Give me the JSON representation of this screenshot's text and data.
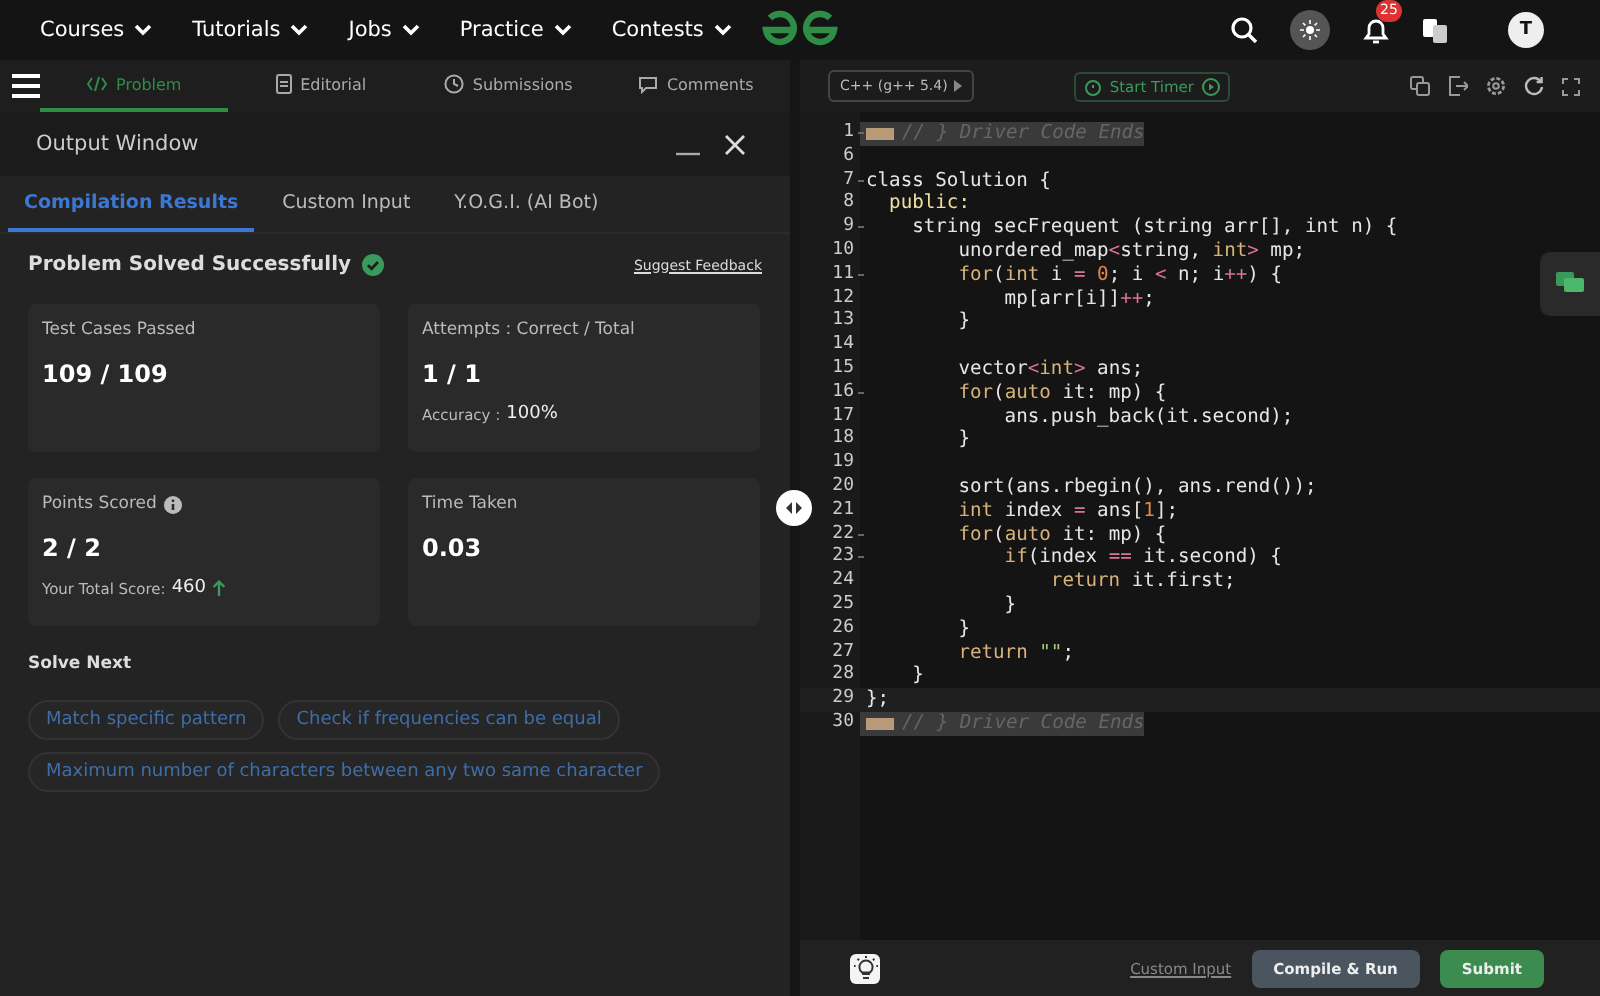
{
  "nav": {
    "menus": [
      "Courses",
      "Tutorials",
      "Jobs",
      "Practice",
      "Contests"
    ],
    "notifications": "25",
    "avatar": "T"
  },
  "problem_tabs": [
    {
      "label": "Problem",
      "kind": "code",
      "selected": true
    },
    {
      "label": "Editorial",
      "kind": "doc",
      "selected": false
    },
    {
      "label": "Submissions",
      "kind": "clock",
      "selected": false
    },
    {
      "label": "Comments",
      "kind": "chat",
      "selected": false
    }
  ],
  "output_window": {
    "title": "Output Window",
    "tabs": [
      {
        "label": "Compilation Results",
        "selected": true
      },
      {
        "label": "Custom Input",
        "selected": false
      },
      {
        "label": "Y.O.G.I. (AI Bot)",
        "selected": false
      }
    ],
    "status": "Problem Solved Successfully",
    "feedback_link": "Suggest Feedback",
    "cards": [
      {
        "label": "Test Cases Passed",
        "value": "109 / 109"
      },
      {
        "label": "Attempts : Correct / Total",
        "value": "1 / 1",
        "note_label": "Accuracy :",
        "note_value": "100%"
      },
      {
        "label": "Points Scored",
        "info": true,
        "value": "2 / 2",
        "note_label": "Your Total Score:",
        "note_value": "460",
        "trend_up": true
      },
      {
        "label": "Time Taken",
        "value": "0.03"
      }
    ],
    "solve_next": {
      "title": "Solve Next",
      "problems": [
        "Match specific pattern",
        "Check if frequencies can be equal",
        "Maximum number of characters between any two same character"
      ]
    }
  },
  "editor": {
    "language": "C++ (g++ 5.4)",
    "timer_button": "Start Timer",
    "lines": [
      {
        "number": "1",
        "foldable": true,
        "folded": true,
        "tokens": [
          {
            "text": "// } Driver Code Ends",
            "kind": "comment"
          }
        ]
      },
      {
        "number": "6"
      },
      {
        "number": "7",
        "foldable": true,
        "tokens": [
          {
            "text": "class Solution {",
            "kind": "plain"
          }
        ]
      },
      {
        "number": "8",
        "tokens": [
          {
            "text": "  public:",
            "kind": "label"
          }
        ]
      },
      {
        "number": "9",
        "foldable": true,
        "tokens": [
          {
            "text": "    string secFrequent (string arr[], int n) {",
            "kind": "plain"
          }
        ]
      },
      {
        "number": "10",
        "tokens": [
          {
            "text": "        unordered_map",
            "kind": "plain"
          },
          {
            "text": "<",
            "kind": "operator"
          },
          {
            "text": "string, ",
            "kind": "plain"
          },
          {
            "text": "int",
            "kind": "keyword"
          },
          {
            "text": ">",
            "kind": "operator"
          },
          {
            "text": " mp;",
            "kind": "plain"
          }
        ]
      },
      {
        "number": "11",
        "foldable": true,
        "tokens": [
          {
            "text": "        for",
            "kind": "keyword"
          },
          {
            "text": "(",
            "kind": "plain"
          },
          {
            "text": "int",
            "kind": "keyword"
          },
          {
            "text": " i ",
            "kind": "plain"
          },
          {
            "text": "=",
            "kind": "operator"
          },
          {
            "text": " 0",
            "kind": "number"
          },
          {
            "text": "; i ",
            "kind": "plain"
          },
          {
            "text": "<",
            "kind": "operator"
          },
          {
            "text": " n; i",
            "kind": "plain"
          },
          {
            "text": "++",
            "kind": "operator"
          },
          {
            "text": ") {",
            "kind": "plain"
          }
        ]
      },
      {
        "number": "12",
        "tokens": [
          {
            "text": "            mp[arr[i]]",
            "kind": "plain"
          },
          {
            "text": "++",
            "kind": "operator"
          },
          {
            "text": ";",
            "kind": "plain"
          }
        ]
      },
      {
        "number": "13",
        "tokens": [
          {
            "text": "        }",
            "kind": "plain"
          }
        ]
      },
      {
        "number": "14"
      },
      {
        "number": "15",
        "tokens": [
          {
            "text": "        vector",
            "kind": "plain"
          },
          {
            "text": "<",
            "kind": "operator"
          },
          {
            "text": "int",
            "kind": "keyword"
          },
          {
            "text": ">",
            "kind": "operator"
          },
          {
            "text": " ans;",
            "kind": "plain"
          }
        ]
      },
      {
        "number": "16",
        "foldable": true,
        "tokens": [
          {
            "text": "        for",
            "kind": "keyword"
          },
          {
            "text": "(",
            "kind": "plain"
          },
          {
            "text": "auto",
            "kind": "keyword"
          },
          {
            "text": " it: mp) {",
            "kind": "plain"
          }
        ]
      },
      {
        "number": "17",
        "tokens": [
          {
            "text": "            ans.push_back(it.second);",
            "kind": "plain"
          }
        ]
      },
      {
        "number": "18",
        "tokens": [
          {
            "text": "        }",
            "kind": "plain"
          }
        ]
      },
      {
        "number": "19"
      },
      {
        "number": "20",
        "tokens": [
          {
            "text": "        sort(ans.rbegin(), ans.rend());",
            "kind": "plain"
          }
        ]
      },
      {
        "number": "21",
        "tokens": [
          {
            "text": "        int",
            "kind": "keyword"
          },
          {
            "text": " index ",
            "kind": "plain"
          },
          {
            "text": "=",
            "kind": "operator"
          },
          {
            "text": " ans[",
            "kind": "plain"
          },
          {
            "text": "1",
            "kind": "number"
          },
          {
            "text": "];",
            "kind": "plain"
          }
        ]
      },
      {
        "number": "22",
        "foldable": true,
        "tokens": [
          {
            "text": "        for",
            "kind": "keyword"
          },
          {
            "text": "(",
            "kind": "plain"
          },
          {
            "text": "auto",
            "kind": "keyword"
          },
          {
            "text": " it: mp) {",
            "kind": "plain"
          }
        ]
      },
      {
        "number": "23",
        "foldable": true,
        "tokens": [
          {
            "text": "            if",
            "kind": "keyword"
          },
          {
            "text": "(index ",
            "kind": "plain"
          },
          {
            "text": "==",
            "kind": "operator"
          },
          {
            "text": " it.second) {",
            "kind": "plain"
          }
        ]
      },
      {
        "number": "24",
        "tokens": [
          {
            "text": "                return",
            "kind": "keyword"
          },
          {
            "text": " it.first;",
            "kind": "plain"
          }
        ]
      },
      {
        "number": "25",
        "tokens": [
          {
            "text": "            }",
            "kind": "plain"
          }
        ]
      },
      {
        "number": "26",
        "tokens": [
          {
            "text": "        }",
            "kind": "plain"
          }
        ]
      },
      {
        "number": "27",
        "tokens": [
          {
            "text": "        return",
            "kind": "keyword"
          },
          {
            "text": " \"\"",
            "kind": "string"
          },
          {
            "text": ";",
            "kind": "plain"
          }
        ]
      },
      {
        "number": "28",
        "tokens": [
          {
            "text": "    }",
            "kind": "plain"
          }
        ]
      },
      {
        "number": "29",
        "active": true,
        "tokens": [
          {
            "text": "};",
            "kind": "plain"
          }
        ]
      },
      {
        "number": "30",
        "folded": true,
        "tokens": [
          {
            "text": "// } Driver Code Ends",
            "kind": "comment"
          }
        ]
      }
    ],
    "custom_input_link": "Custom Input",
    "compile_button": "Compile & Run",
    "submit_button": "Submit"
  }
}
